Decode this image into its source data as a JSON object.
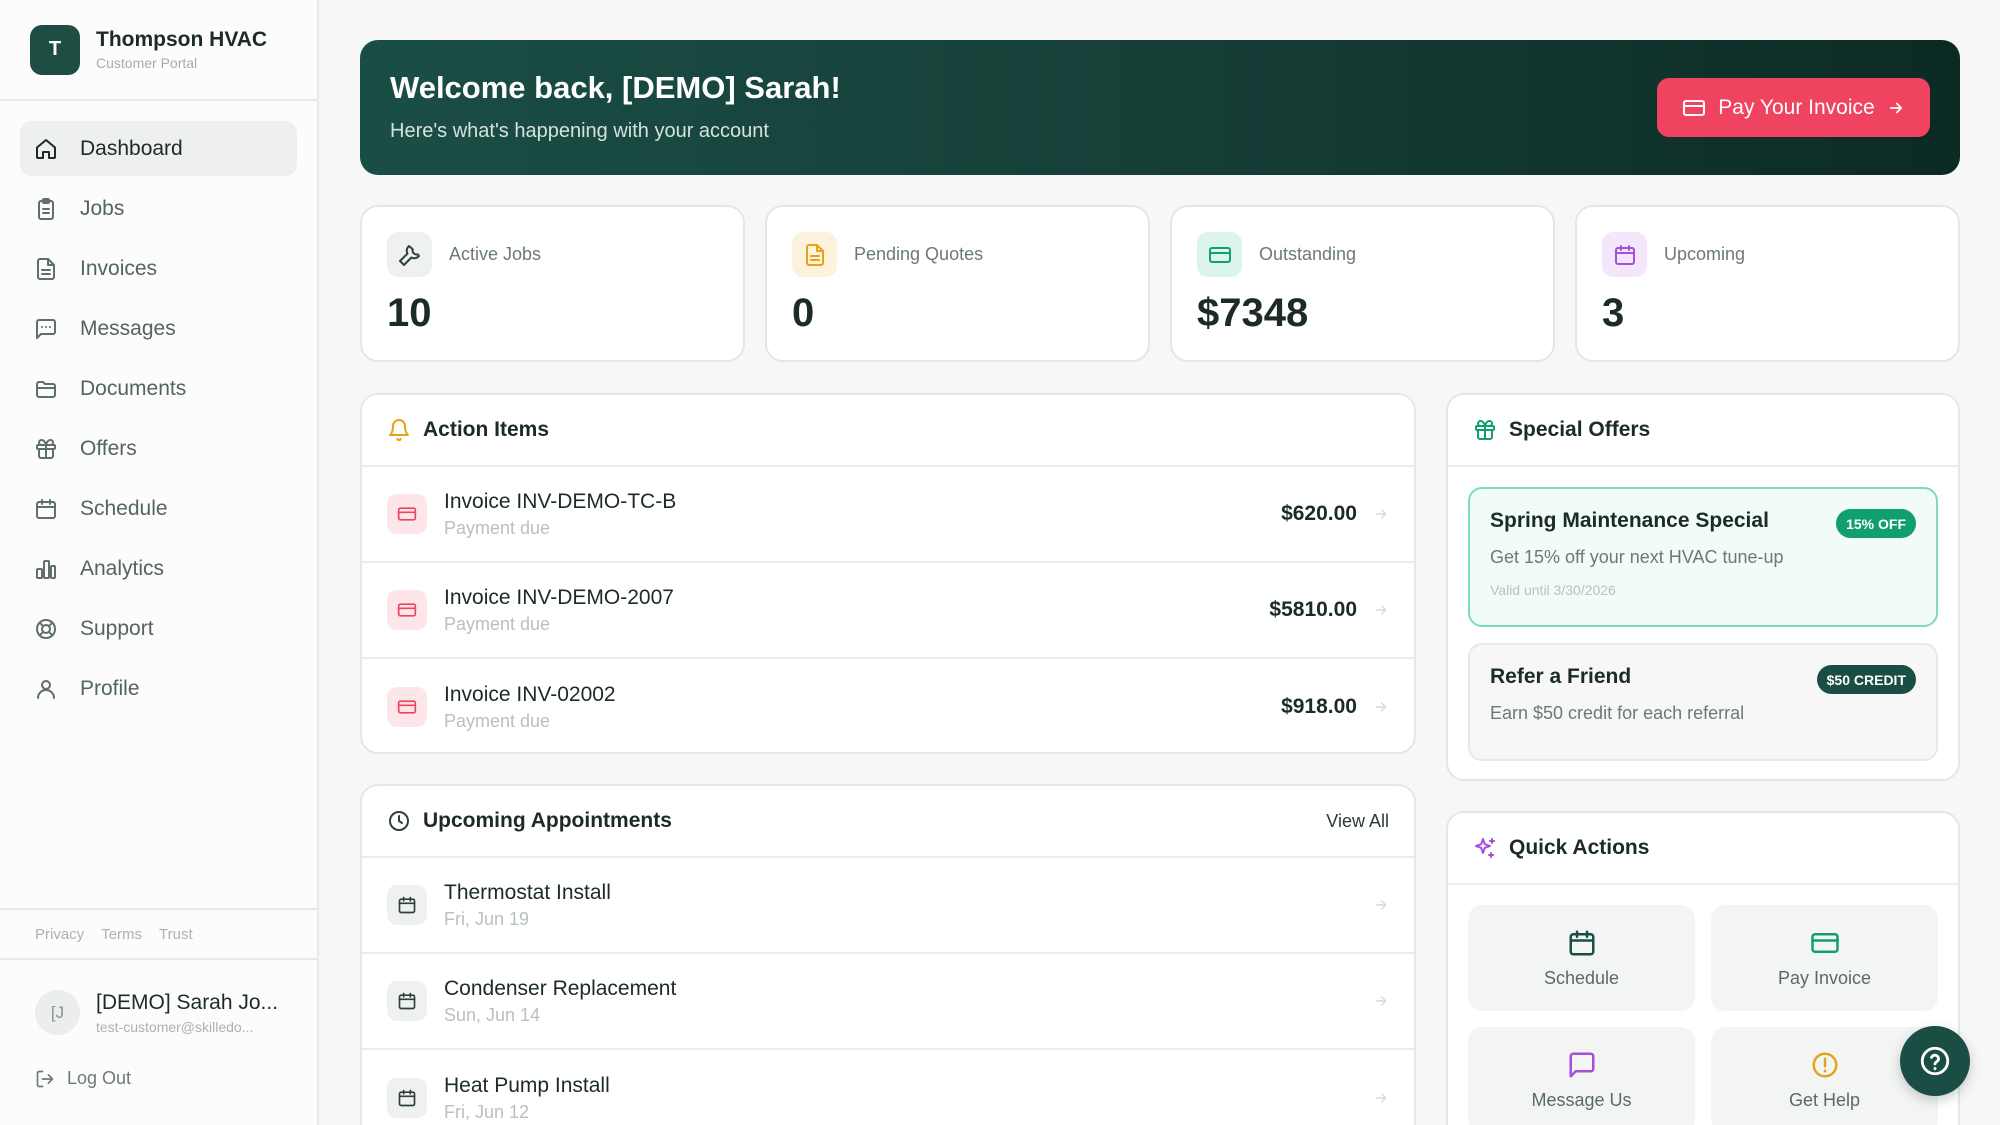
{
  "brand": {
    "initial": "T",
    "name": "Thompson HVAC",
    "subtitle": "Customer Portal"
  },
  "nav": [
    {
      "label": "Dashboard",
      "icon": "home-icon",
      "active": true
    },
    {
      "label": "Jobs",
      "icon": "clipboard-icon"
    },
    {
      "label": "Invoices",
      "icon": "document-icon"
    },
    {
      "label": "Messages",
      "icon": "message-icon"
    },
    {
      "label": "Documents",
      "icon": "folder-icon"
    },
    {
      "label": "Offers",
      "icon": "gift-icon"
    },
    {
      "label": "Schedule",
      "icon": "calendar-icon"
    },
    {
      "label": "Analytics",
      "icon": "bar-chart-icon"
    },
    {
      "label": "Support",
      "icon": "lifebuoy-icon"
    },
    {
      "label": "Profile",
      "icon": "user-icon"
    }
  ],
  "legal": {
    "privacy": "Privacy",
    "terms": "Terms",
    "trust": "Trust"
  },
  "user": {
    "initials": "[J",
    "name": "[DEMO] Sarah Jo...",
    "email": "test-customer@skilledo..."
  },
  "logout": "Log Out",
  "hero": {
    "title": "Welcome back, [DEMO] Sarah!",
    "subtitle": "Here's what's happening with your account",
    "pay_label": "Pay Your Invoice"
  },
  "stats": [
    {
      "label": "Active Jobs",
      "value": "10",
      "icon": "wrench-icon"
    },
    {
      "label": "Pending Quotes",
      "value": "0",
      "icon": "document-icon"
    },
    {
      "label": "Outstanding",
      "value": "$7348",
      "icon": "credit-card-icon"
    },
    {
      "label": "Upcoming",
      "value": "3",
      "icon": "calendar-icon"
    }
  ],
  "action_items": {
    "title": "Action Items",
    "items": [
      {
        "title": "Invoice INV-DEMO-TC-B",
        "sub": "Payment due",
        "amount": "$620.00"
      },
      {
        "title": "Invoice INV-DEMO-2007",
        "sub": "Payment due",
        "amount": "$5810.00"
      },
      {
        "title": "Invoice INV-02002",
        "sub": "Payment due",
        "amount": "$918.00"
      }
    ]
  },
  "appointments": {
    "title": "Upcoming Appointments",
    "view_all": "View All",
    "items": [
      {
        "title": "Thermostat Install",
        "date": "Fri, Jun 19"
      },
      {
        "title": "Condenser Replacement",
        "date": "Sun, Jun 14"
      },
      {
        "title": "Heat Pump Install",
        "date": "Fri, Jun 12"
      }
    ]
  },
  "offers": {
    "title": "Special Offers",
    "items": [
      {
        "title": "Spring Maintenance Special",
        "desc": "Get 15% off your next HVAC tune-up",
        "valid": "Valid until 3/30/2026",
        "badge": "15% OFF"
      },
      {
        "title": "Refer a Friend",
        "desc": "Earn $50 credit for each referral",
        "badge": "$50 CREDIT"
      }
    ]
  },
  "quick_actions": {
    "title": "Quick Actions",
    "items": [
      {
        "label": "Schedule",
        "icon": "calendar-icon"
      },
      {
        "label": "Pay Invoice",
        "icon": "credit-card-icon"
      },
      {
        "label": "Message Us",
        "icon": "message-icon"
      },
      {
        "label": "Get Help",
        "icon": "alert-circle-icon"
      }
    ]
  },
  "colors": {
    "primary": "#1a4e45",
    "accent": "#ef4360",
    "success": "#10a070",
    "purple": "#a64fd9",
    "amber": "#e8a21a"
  }
}
